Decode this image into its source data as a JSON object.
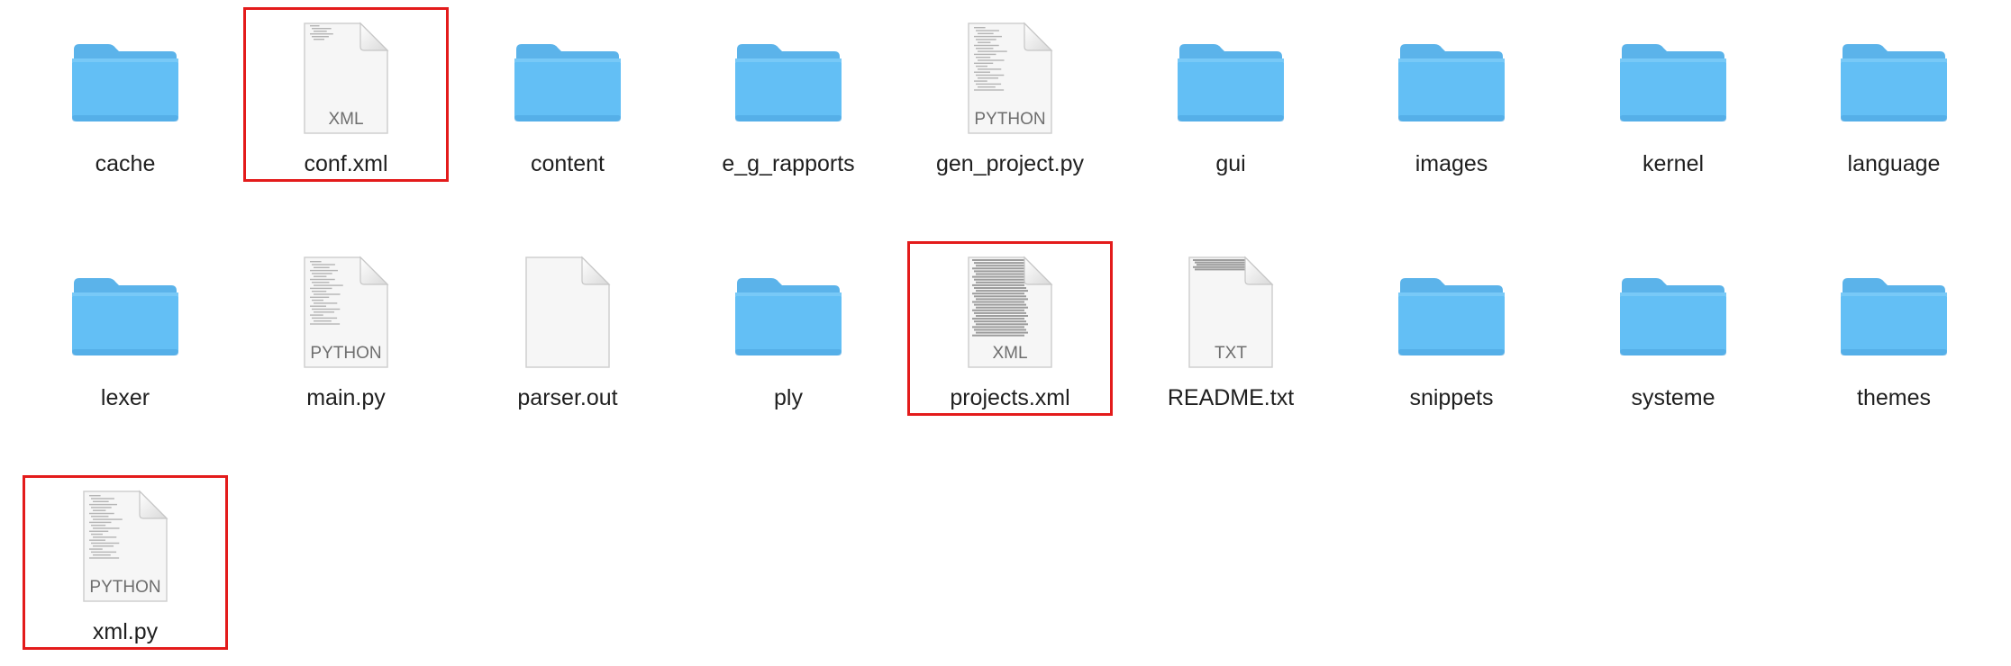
{
  "window": {
    "view": "icon-grid",
    "background": "#ffffff"
  },
  "colors": {
    "folder_main": "#63bff5",
    "folder_tab": "#5bb3ea",
    "folder_shade": "#4aa2dc",
    "document": "#f6f6f6",
    "highlight": "#e31b1b"
  },
  "items": [
    {
      "name": "cache",
      "kind": "folder",
      "icon": "folder-icon"
    },
    {
      "name": "conf.xml",
      "kind": "document",
      "icon": "xml-document-icon",
      "type_label": "XML",
      "highlighted": true
    },
    {
      "name": "content",
      "kind": "folder",
      "icon": "folder-icon"
    },
    {
      "name": "e_g_rapports",
      "kind": "folder",
      "icon": "folder-icon"
    },
    {
      "name": "gen_project.py",
      "kind": "document",
      "icon": "python-document-icon",
      "type_label": "PYTHON"
    },
    {
      "name": "gui",
      "kind": "folder",
      "icon": "folder-icon"
    },
    {
      "name": "images",
      "kind": "folder",
      "icon": "folder-icon"
    },
    {
      "name": "kernel",
      "kind": "folder",
      "icon": "folder-icon"
    },
    {
      "name": "language",
      "kind": "folder",
      "icon": "folder-icon"
    },
    {
      "name": "lexer",
      "kind": "folder",
      "icon": "folder-icon"
    },
    {
      "name": "main.py",
      "kind": "document",
      "icon": "python-document-icon",
      "type_label": "PYTHON"
    },
    {
      "name": "parser.out",
      "kind": "document",
      "icon": "blank-document-icon",
      "type_label": ""
    },
    {
      "name": "ply",
      "kind": "folder",
      "icon": "folder-icon"
    },
    {
      "name": "projects.xml",
      "kind": "document",
      "icon": "xml-document-icon",
      "type_label": "XML",
      "highlighted": true
    },
    {
      "name": "README.txt",
      "kind": "document",
      "icon": "text-document-icon",
      "type_label": "TXT"
    },
    {
      "name": "snippets",
      "kind": "folder",
      "icon": "folder-icon"
    },
    {
      "name": "systeme",
      "kind": "folder",
      "icon": "folder-icon"
    },
    {
      "name": "themes",
      "kind": "folder",
      "icon": "folder-icon"
    },
    {
      "name": "xml.py",
      "kind": "document",
      "icon": "python-document-icon",
      "type_label": "PYTHON",
      "highlighted": true
    }
  ]
}
